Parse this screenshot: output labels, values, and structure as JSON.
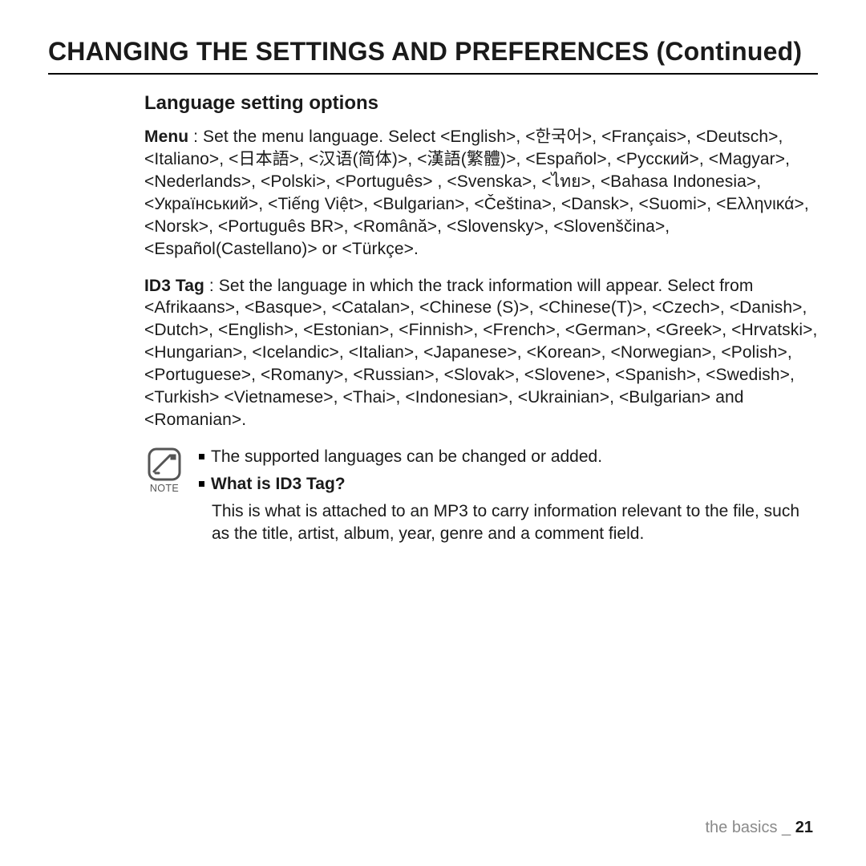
{
  "title": "CHANGING THE SETTINGS AND PREFERENCES (Continued)",
  "section_heading": "Language setting options",
  "menu_label": "Menu",
  "menu_text": " : Set the menu language. Select <English>, <한국어>, <Français>, <Deutsch>, <Italiano>, <日本語>, <汉语(简体)>, <漢語(繁體)>, <Español>, <Русский>, <Magyar>, <Nederlands>, <Polski>, <Português> , <Svenska>, <ไทย>, <Bahasa Indonesia>, <Український>, <Tiếng Việt>, <Bulgarian>, <Čeština>, <Dansk>, <Suomi>, <Ελληνικά>, <Norsk>, <Português BR>, <Română>, <Slovensky>, <Slovenščina>, <Español(Castellano)> or <Türkçe>.",
  "id3_label": "ID3 Tag",
  "id3_text": " : Set the language in which the track information will appear. Select from <Afrikaans>, <Basque>, <Catalan>, <Chinese (S)>, <Chinese(T)>, <Czech>, <Danish>, <Dutch>, <English>, <Estonian>, <Finnish>, <French>, <German>, <Greek>, <Hrvatski>, <Hungarian>, <Icelandic>, <Italian>, <Japanese>, <Korean>, <Norwegian>, <Polish>, <Portuguese>, <Romany>, <Russian>, <Slovak>, <Slovene>, <Spanish>, <Swedish>, <Turkish> <Vietnamese>, <Thai>, <Indonesian>, <Ukrainian>, <Bulgarian> and <Romanian>.",
  "note_label": "NOTE",
  "note_bullet1": "The supported languages can be changed or added.",
  "note_bullet2_title": "What is ID3 Tag?",
  "note_bullet2_body": "This is what is attached to an MP3 to carry information relevant to the file, such as the title, artist, album, year, genre and a comment field.",
  "footer_text": "the basics _ ",
  "footer_page": "21"
}
